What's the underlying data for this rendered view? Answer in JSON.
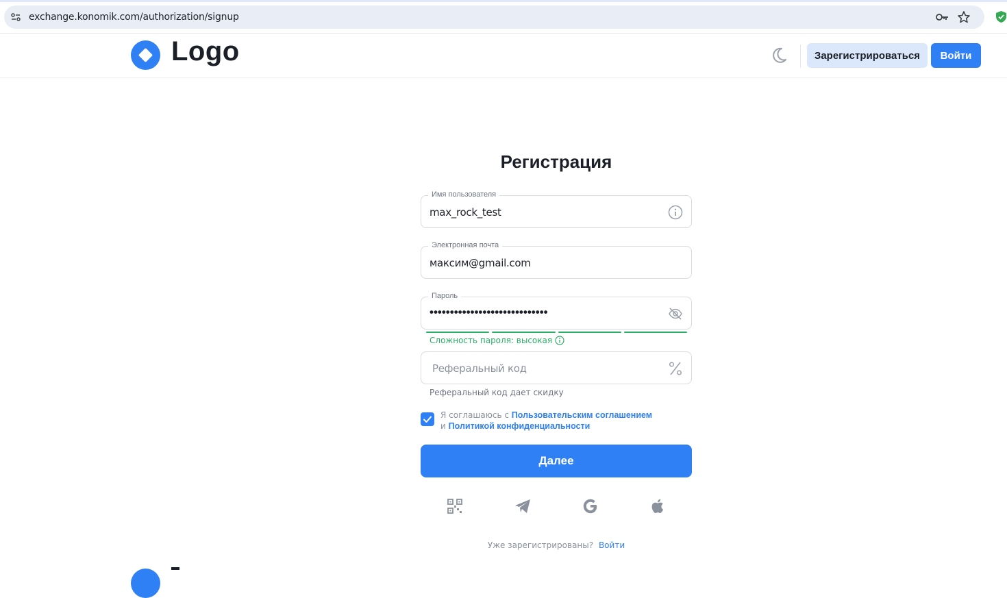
{
  "browser": {
    "url": "exchange.konomik.com/authorization/signup"
  },
  "header": {
    "logo_text": "Logo",
    "signup_label": "Зарегистрироваться",
    "login_label": "Войти"
  },
  "form": {
    "title": "Регистрация",
    "username": {
      "label": "Имя пользователя",
      "value": "max_rock_test"
    },
    "email": {
      "label": "Электронная почта",
      "value": "максим@gmail.com"
    },
    "password": {
      "label": "Пароль",
      "value": "•••••••••••••••••••••••••••••"
    },
    "strength_text": "Сложность пароля: высокая",
    "referral": {
      "placeholder": "Реферальный код",
      "hint": "Реферальный код дает скидку"
    },
    "consent": {
      "prefix": "Я соглашаюсь с",
      "terms_link": "Пользовательским соглашением",
      "middle": "и",
      "privacy_link": "Политикой конфиденциальности",
      "checked": true
    },
    "submit_label": "Далее",
    "social_icons": [
      "qr-code-icon",
      "telegram-icon",
      "google-icon",
      "apple-icon"
    ],
    "already_registered": "Уже зарегистрированы?",
    "login_link": "Войти"
  },
  "colors": {
    "accent": "#2f80f5",
    "accent_light": "#dbe8fc",
    "success": "#2bae66"
  }
}
